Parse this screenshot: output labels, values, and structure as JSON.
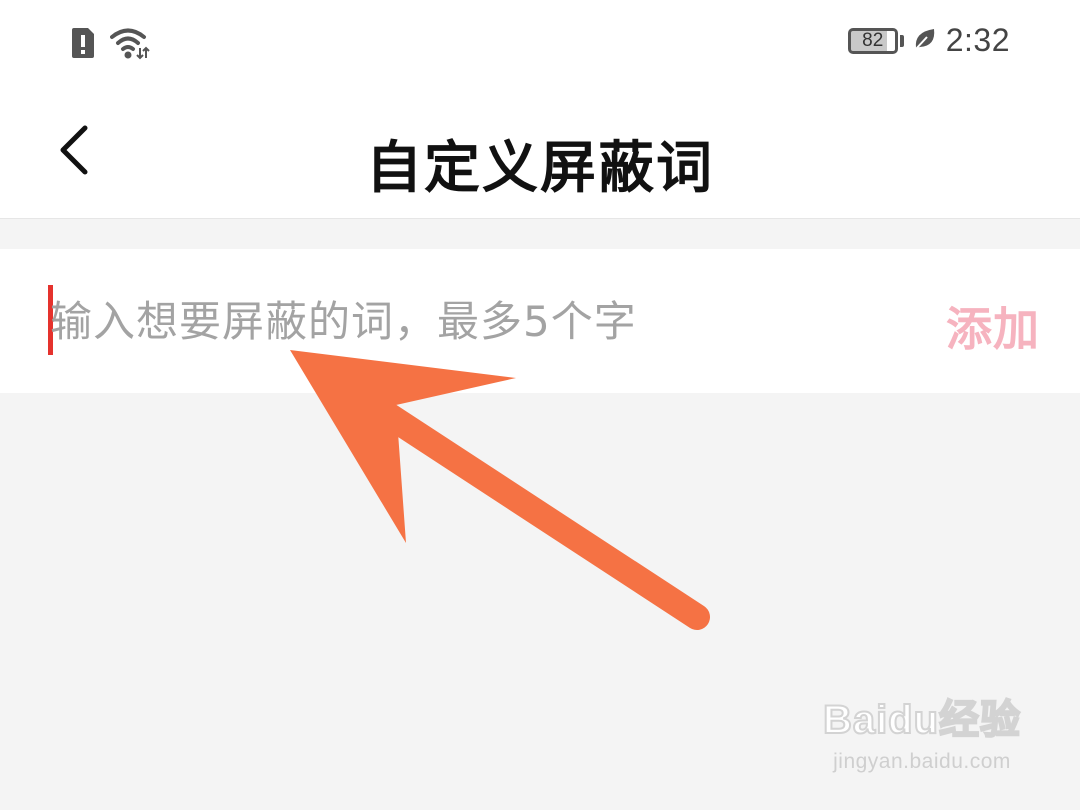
{
  "status_bar": {
    "icons_left": [
      "sim-alert-icon",
      "wifi-icon"
    ],
    "battery_level": "82",
    "icons_right": [
      "battery-icon",
      "leaf-icon"
    ],
    "time": "2:32"
  },
  "header": {
    "back_icon": "chevron-left-icon",
    "title": "自定义屏蔽词"
  },
  "input": {
    "value": "",
    "placeholder": "输入想要屏蔽的词，最多5个字",
    "add_label": "添加"
  },
  "watermark": {
    "brand": "Baidu经验",
    "url": "jingyan.baidu.com"
  },
  "colors": {
    "annotation_arrow": "#f57244",
    "add_button": "#f6b3bf",
    "cursor": "#e5322d",
    "page_background": "#f4f4f4"
  }
}
